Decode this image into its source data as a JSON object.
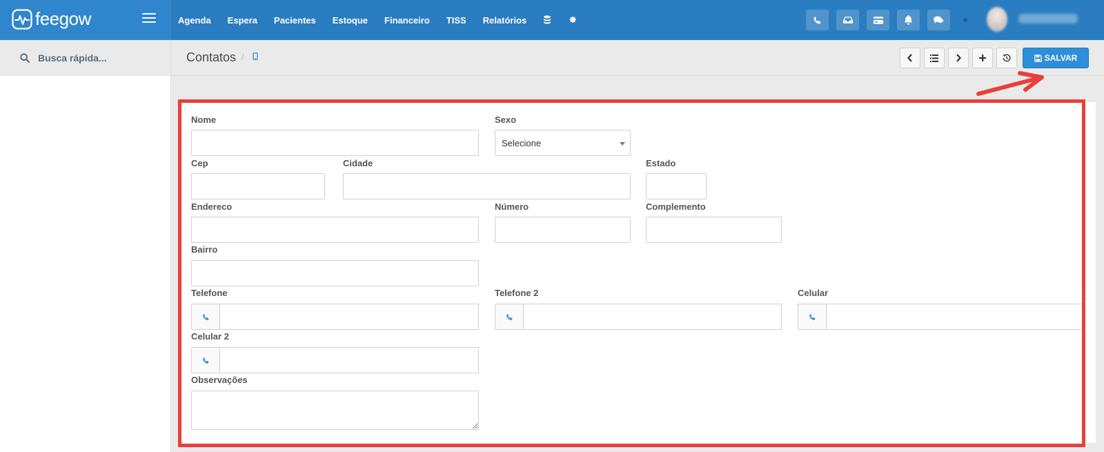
{
  "brand": {
    "name": "feegow"
  },
  "nav": {
    "items": [
      "Agenda",
      "Espera",
      "Pacientes",
      "Estoque",
      "Financeiro",
      "TISS",
      "Relatórios"
    ],
    "extra_icons": [
      "database-icon",
      "gear-icon"
    ]
  },
  "topbar": {
    "buttons": [
      "phone-icon",
      "inbox-icon",
      "card-icon",
      "bell-icon",
      "chat-icon"
    ]
  },
  "sidebar": {
    "search_placeholder": "Busca rápida..."
  },
  "header": {
    "title": "Contatos",
    "separator": "/",
    "save_label": "SALVAR"
  },
  "form": {
    "nome": {
      "label": "Nome",
      "value": ""
    },
    "sexo": {
      "label": "Sexo",
      "selected": "Selecione"
    },
    "cep": {
      "label": "Cep",
      "value": ""
    },
    "cidade": {
      "label": "Cidade",
      "value": ""
    },
    "estado": {
      "label": "Estado",
      "value": ""
    },
    "endereco": {
      "label": "Endereco",
      "value": ""
    },
    "numero": {
      "label": "Número",
      "value": ""
    },
    "complemento": {
      "label": "Complemento",
      "value": ""
    },
    "bairro": {
      "label": "Bairro",
      "value": ""
    },
    "telefone": {
      "label": "Telefone",
      "value": ""
    },
    "telefone2": {
      "label": "Telefone 2",
      "value": ""
    },
    "celular": {
      "label": "Celular",
      "value": ""
    },
    "celular2": {
      "label": "Celular 2",
      "value": ""
    },
    "observacoes": {
      "label": "Observações",
      "value": ""
    }
  },
  "colors": {
    "topbar": "#2a7dc0",
    "brand_bg": "#2f86cc",
    "accent": "#2d8fd8",
    "highlight": "#e8403a"
  }
}
